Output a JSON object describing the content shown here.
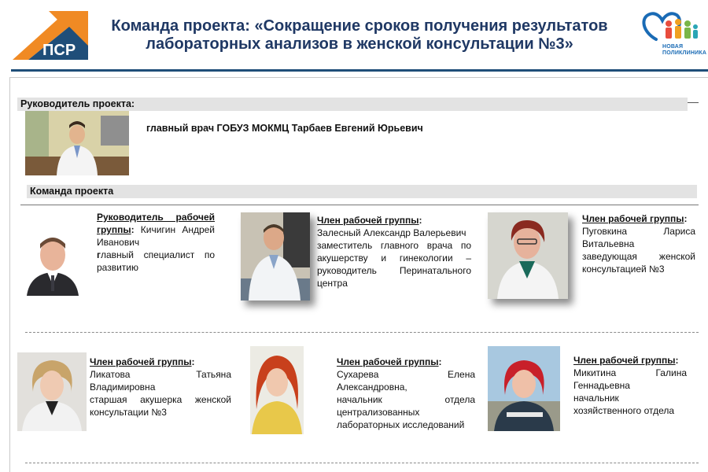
{
  "header": {
    "title_line1": "Команда проекта: «Сокращение сроков получения результатов",
    "title_line2": "лабораторных анализов  в женской консультации №3»",
    "logo_left_text": "ПСР",
    "logo_right_text_line1": "НОВАЯ",
    "logo_right_text_line2": "ПОЛИКЛИНИКА"
  },
  "project_lead": {
    "section_label": "Руководитель проекта:",
    "description": "главный врач ГОБУЗ МОКМЦ Тарбаев Евгений Юрьевич"
  },
  "team": {
    "section_label": "Команда проекта",
    "members": [
      {
        "role": "Руководитель рабочей группы",
        "name": "Кичигин Андрей Иванович",
        "position_bold_prefix": "г",
        "position": "лавный специалист по развитию"
      },
      {
        "role": "Член рабочей группы",
        "name": "Залесный Александр Валерьевич",
        "position": "заместитель главного врача по акушерству и гинекологии – руководитель Перинатального центра"
      },
      {
        "role": "Член рабочей группы",
        "name": "Пуговкина Лариса Витальевна",
        "position": "заведующая женской консультацией №3"
      },
      {
        "role": "Член рабочей группы",
        "name": "Ликатова Татьяна Владимировна",
        "position": "старшая акушерка женской консультации №3"
      },
      {
        "role": "Член рабочей группы",
        "name": "Сухарева Елена Александровна,",
        "position": "начальник отдела централизованных лабораторных исследований"
      },
      {
        "role": "Член рабочей группы",
        "name": "Микитина Галина Геннадьевна",
        "position": "начальник хозяйственного отдела"
      }
    ]
  },
  "colors": {
    "title": "#1f3864",
    "accent_orange": "#f08a24",
    "accent_blue": "#1f4e79",
    "section_bar": "#e3e3e3"
  }
}
